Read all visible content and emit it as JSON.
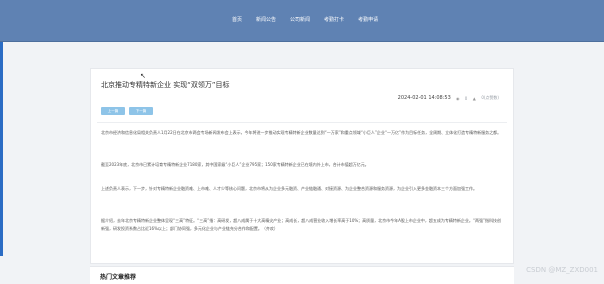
{
  "nav": {
    "items": [
      {
        "label": "首页"
      },
      {
        "label": "新闻公告"
      },
      {
        "label": "公司新闻"
      },
      {
        "label": "考勤打卡"
      },
      {
        "label": "考勤申请"
      }
    ]
  },
  "article": {
    "title": "北京推动专精特新企业 实现“双领万”目标",
    "datetime": "2024-02-01 14:08:53",
    "icons": {
      "views": "eye-icon",
      "likes": "thumb-icon"
    },
    "views_label": "0",
    "likes_label": "0(点赞数)",
    "buttons": [
      {
        "label": "上一篇"
      },
      {
        "label": "下一篇"
      }
    ],
    "paragraphs": [
      "北京市经济和信息化局相关负责人1月22日在北京市两会专场新闻发布会上表示，今年将进一步推动实现专精特新企业数量达到“一万家”和重点领域“小巨人”企业“一万亿”作为目标任务，全周期、立体化打造专精特新服务之都。",
      "截至2023年底，北京市已累计培育专精特新企业7180家，其中国家级“小巨人”企业795家；150家专精特新企业已在境内外上市，合计市值超万亿元。",
      "上述负责人表示，下一步，针对专精特新企业融资难、上市难、人才少等核心问题，北京市将从为企业多元融资、产业链融通、对接资源、为企业整合资源和服务资源，为企业引入更多金融资本三个方面加强工作。",
      "据介绍，去年北京专精特新企业整体呈现“三高”特征。“三高”指：高研发，超八成属于十大高精尖产业；高成长，超八成营业收入增长率高于10%；高质量，北京市今年A股上市企业中，超五成为专精特新企业。“两强”指科技创新强，研发投资系数占比近16%以上；部门协同强，多元化企业与产业链充分合作和配置。（齐欢）"
    ]
  },
  "hot": {
    "title": "热门文章推荐"
  },
  "watermark": "CSDN @MZ_ZXD001",
  "colors": {
    "nav_bg": "#5f82b3",
    "button_bg": "#8ec4e8",
    "accent_bar": "#2b6cc4"
  }
}
